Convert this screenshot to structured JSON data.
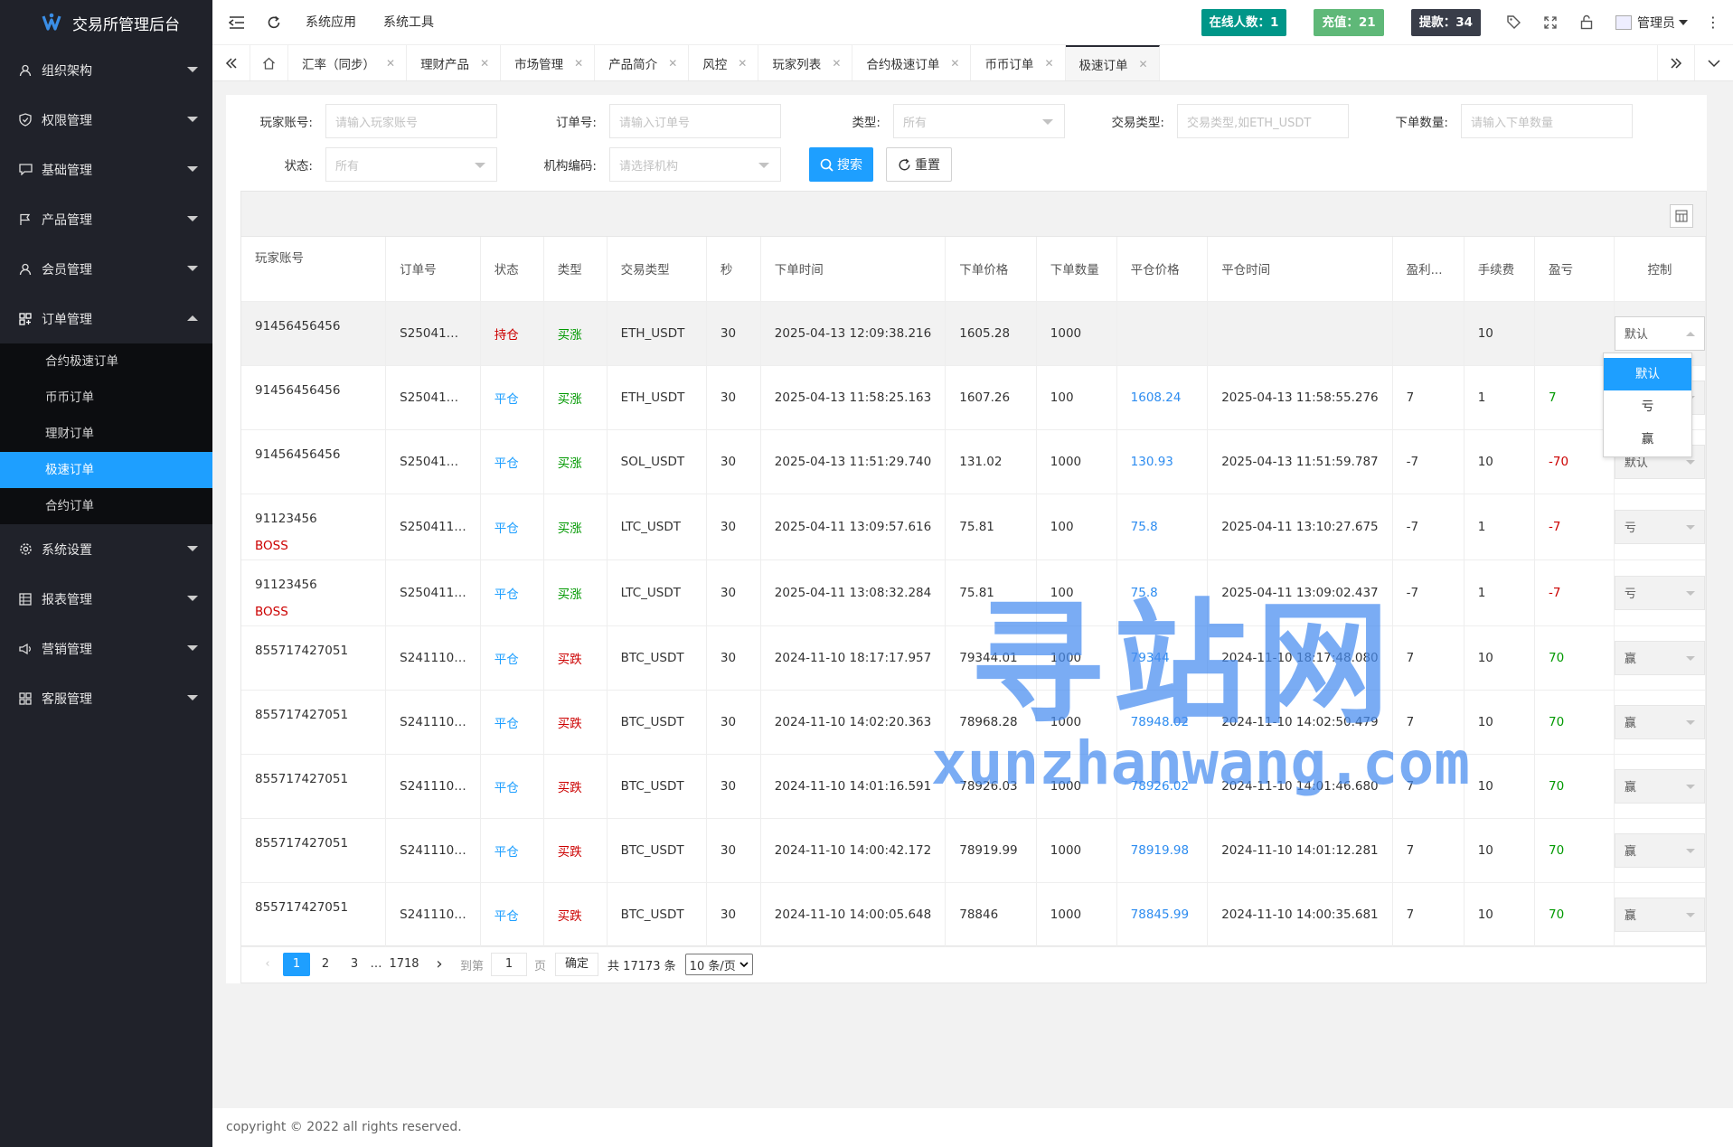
{
  "app": {
    "title": "交易所管理后台"
  },
  "sidebar": {
    "items": [
      {
        "label": "组织架构",
        "icon": "user-icon"
      },
      {
        "label": "权限管理",
        "icon": "shield-icon"
      },
      {
        "label": "基础管理",
        "icon": "chat-icon"
      },
      {
        "label": "产品管理",
        "icon": "flag-icon"
      },
      {
        "label": "会员管理",
        "icon": "member-icon"
      },
      {
        "label": "订单管理",
        "icon": "apps-icon",
        "open": true
      },
      {
        "label": "系统设置",
        "icon": "gear-icon"
      },
      {
        "label": "报表管理",
        "icon": "table-icon"
      },
      {
        "label": "营销管理",
        "icon": "speaker-icon"
      },
      {
        "label": "客服管理",
        "icon": "grid-icon"
      }
    ],
    "sub_items": [
      {
        "label": "合约极速订单"
      },
      {
        "label": "币币订单"
      },
      {
        "label": "理财订单"
      },
      {
        "label": "极速订单",
        "active": true
      },
      {
        "label": "合约订单"
      }
    ]
  },
  "header": {
    "nav": [
      "系统应用",
      "系统工具"
    ],
    "badges": [
      {
        "label": "在线人数：1",
        "color": "#009688"
      },
      {
        "label": "充值：21",
        "color": "#5fb878"
      },
      {
        "label": "提款：34",
        "color": "#393d49"
      }
    ],
    "user": "管理员"
  },
  "tabs": [
    {
      "label": "汇率（同步）"
    },
    {
      "label": "理财产品"
    },
    {
      "label": "市场管理"
    },
    {
      "label": "产品简介"
    },
    {
      "label": "风控"
    },
    {
      "label": "玩家列表"
    },
    {
      "label": "合约极速订单"
    },
    {
      "label": "币币订单"
    },
    {
      "label": "极速订单",
      "active": true
    }
  ],
  "filters": {
    "player_account": {
      "label": "玩家账号:",
      "placeholder": "请输入玩家账号"
    },
    "order_no": {
      "label": "订单号:",
      "placeholder": "请输入订单号"
    },
    "type": {
      "label": "类型:",
      "value": "所有"
    },
    "trade_type": {
      "label": "交易类型:",
      "placeholder": "交易类型,如ETH_USDT"
    },
    "order_qty": {
      "label": "下单数量:",
      "placeholder": "请输入下单数量"
    },
    "status": {
      "label": "状态:",
      "value": "所有"
    },
    "org_code": {
      "label": "机构编码:",
      "value": "请选择机构"
    },
    "search_label": "搜索",
    "reset_label": "重置"
  },
  "table": {
    "columns": [
      "玩家账号",
      "订单号",
      "状态",
      "类型",
      "交易类型",
      "秒",
      "下单时间",
      "下单价格",
      "下单数量",
      "平仓价格",
      "平仓时间",
      "盈利...",
      "手续费",
      "盈亏",
      "控制"
    ],
    "rows": [
      {
        "account": "91456456456",
        "tag": "",
        "order": "S25041…",
        "status": "持仓",
        "status_color": "red",
        "type": "买涨",
        "type_color": "green",
        "trade": "ETH_USDT",
        "sec": "30",
        "time": "2025-04-13 12:09:38.216",
        "price": "1605.28",
        "qty": "1000",
        "close_price": "",
        "close_time": "",
        "profit_rate": "",
        "fee": "10",
        "pnl": "",
        "pnl_color": "",
        "ctrl": "默认"
      },
      {
        "account": "91456456456",
        "tag": "",
        "order": "S25041…",
        "status": "平仓",
        "status_color": "blue",
        "type": "买涨",
        "type_color": "green",
        "trade": "ETH_USDT",
        "sec": "30",
        "time": "2025-04-13 11:58:25.163",
        "price": "1607.26",
        "qty": "100",
        "close_price": "1608.24",
        "close_time": "2025-04-13 11:58:55.276",
        "profit_rate": "7",
        "fee": "1",
        "pnl": "7",
        "pnl_color": "green",
        "ctrl": "赢"
      },
      {
        "account": "91456456456",
        "tag": "",
        "order": "S25041…",
        "status": "平仓",
        "status_color": "blue",
        "type": "买涨",
        "type_color": "green",
        "trade": "SOL_USDT",
        "sec": "30",
        "time": "2025-04-13 11:51:29.740",
        "price": "131.02",
        "qty": "1000",
        "close_price": "130.93",
        "close_time": "2025-04-13 11:51:59.787",
        "profit_rate": "-7",
        "fee": "10",
        "pnl": "-70",
        "pnl_color": "red",
        "ctrl": "默认"
      },
      {
        "account": "91123456",
        "tag": "BOSS",
        "order": "S250411…",
        "status": "平仓",
        "status_color": "blue",
        "type": "买涨",
        "type_color": "green",
        "trade": "LTC_USDT",
        "sec": "30",
        "time": "2025-04-11 13:09:57.616",
        "price": "75.81",
        "qty": "100",
        "close_price": "75.8",
        "close_time": "2025-04-11 13:10:27.675",
        "profit_rate": "-7",
        "fee": "1",
        "pnl": "-7",
        "pnl_color": "red",
        "ctrl": "亏"
      },
      {
        "account": "91123456",
        "tag": "BOSS",
        "order": "S250411…",
        "status": "平仓",
        "status_color": "blue",
        "type": "买涨",
        "type_color": "green",
        "trade": "LTC_USDT",
        "sec": "30",
        "time": "2025-04-11 13:08:32.284",
        "price": "75.81",
        "qty": "100",
        "close_price": "75.8",
        "close_time": "2025-04-11 13:09:02.437",
        "profit_rate": "-7",
        "fee": "1",
        "pnl": "-7",
        "pnl_color": "red",
        "ctrl": "亏"
      },
      {
        "account": "855717427051",
        "tag": "",
        "order": "S241110…",
        "status": "平仓",
        "status_color": "blue",
        "type": "买跌",
        "type_color": "red",
        "trade": "BTC_USDT",
        "sec": "30",
        "time": "2024-11-10 18:17:17.957",
        "price": "79344.01",
        "qty": "1000",
        "close_price": "79344",
        "close_time": "2024-11-10 18:17:48.080",
        "profit_rate": "7",
        "fee": "10",
        "pnl": "70",
        "pnl_color": "green",
        "ctrl": "赢"
      },
      {
        "account": "855717427051",
        "tag": "",
        "order": "S241110…",
        "status": "平仓",
        "status_color": "blue",
        "type": "买跌",
        "type_color": "red",
        "trade": "BTC_USDT",
        "sec": "30",
        "time": "2024-11-10 14:02:20.363",
        "price": "78968.28",
        "qty": "1000",
        "close_price": "78948.02",
        "close_time": "2024-11-10 14:02:50.479",
        "profit_rate": "7",
        "fee": "10",
        "pnl": "70",
        "pnl_color": "green",
        "ctrl": "赢"
      },
      {
        "account": "855717427051",
        "tag": "",
        "order": "S241110…",
        "status": "平仓",
        "status_color": "blue",
        "type": "买跌",
        "type_color": "red",
        "trade": "BTC_USDT",
        "sec": "30",
        "time": "2024-11-10 14:01:16.591",
        "price": "78926.03",
        "qty": "1000",
        "close_price": "78926.02",
        "close_time": "2024-11-10 14:01:46.680",
        "profit_rate": "7",
        "fee": "10",
        "pnl": "70",
        "pnl_color": "green",
        "ctrl": "赢"
      },
      {
        "account": "855717427051",
        "tag": "",
        "order": "S241110…",
        "status": "平仓",
        "status_color": "blue",
        "type": "买跌",
        "type_color": "red",
        "trade": "BTC_USDT",
        "sec": "30",
        "time": "2024-11-10 14:00:42.172",
        "price": "78919.99",
        "qty": "1000",
        "close_price": "78919.98",
        "close_time": "2024-11-10 14:01:12.281",
        "profit_rate": "7",
        "fee": "10",
        "pnl": "70",
        "pnl_color": "green",
        "ctrl": "赢"
      },
      {
        "account": "855717427051",
        "tag": "",
        "order": "S241110…",
        "status": "平仓",
        "status_color": "blue",
        "type": "买跌",
        "type_color": "red",
        "trade": "BTC_USDT",
        "sec": "30",
        "time": "2024-11-10 14:00:05.648",
        "price": "78846",
        "qty": "1000",
        "close_price": "78845.99",
        "close_time": "2024-11-10 14:00:35.681",
        "profit_rate": "7",
        "fee": "10",
        "pnl": "70",
        "pnl_color": "green",
        "ctrl": "赢"
      }
    ]
  },
  "dropdown": {
    "options": [
      "默认",
      "亏",
      "赢"
    ],
    "selected": "默认"
  },
  "pagination": {
    "pages": [
      "1",
      "2",
      "3",
      "…",
      "1718"
    ],
    "current": "1",
    "goto_label": "到第",
    "goto_value": "1",
    "page_unit": "页",
    "confirm_label": "确定",
    "total": "共 17173 条",
    "per_page": "10 条/页"
  },
  "watermark": {
    "big": "寻站网",
    "small": "xunzhanwang.com"
  },
  "footer": {
    "text": "copyright © 2022 all rights reserved."
  }
}
